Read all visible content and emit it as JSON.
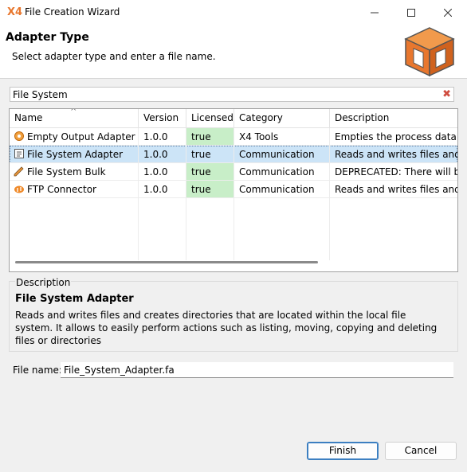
{
  "window": {
    "app_icon_text": "X4",
    "title": "File Creation Wizard"
  },
  "controls": {
    "minimize": "–",
    "maximize": "☐",
    "close": "✕"
  },
  "header": {
    "heading": "Adapter Type",
    "subtitle": "Select adapter type and enter a file name."
  },
  "search": {
    "value": "File System",
    "clear_icon": "✖"
  },
  "table": {
    "sort_indicator": "^",
    "columns": [
      "Name",
      "Version",
      "Licensed",
      "Category",
      "Description"
    ],
    "rows": [
      {
        "name": "Empty Output Adapter",
        "icon": "gear-icon",
        "version": "1.0.0",
        "licensed": "true",
        "category": "X4 Tools",
        "description": "Empties the process data stre"
      },
      {
        "name": "File System Adapter",
        "icon": "file-icon",
        "version": "1.0.0",
        "licensed": "true",
        "category": "Communication",
        "description": "Reads and writes files and cre"
      },
      {
        "name": "File System Bulk",
        "icon": "pencil-icon",
        "version": "1.0.0",
        "licensed": "true",
        "category": "Communication",
        "description": "DEPRECATED: There will be a"
      },
      {
        "name": "FTP Connector",
        "icon": "ftp-icon",
        "version": "1.0.0",
        "licensed": "true",
        "category": "Communication",
        "description": "Reads and writes files and cre"
      }
    ],
    "selected_index": 1
  },
  "description": {
    "legend": "Description",
    "title": "File System Adapter",
    "text": "Reads and writes files and creates directories that are located within the local file system. It allows to easily perform actions such as listing, moving, copying and deleting files or directories"
  },
  "filename": {
    "label": "File name:",
    "value": "File_System_Adapter.fa"
  },
  "buttons": {
    "finish": "Finish",
    "cancel": "Cancel"
  },
  "colors": {
    "accent": "#e8772e",
    "selection": "#cce4f7",
    "licensed_ok": "#c8eec8"
  }
}
